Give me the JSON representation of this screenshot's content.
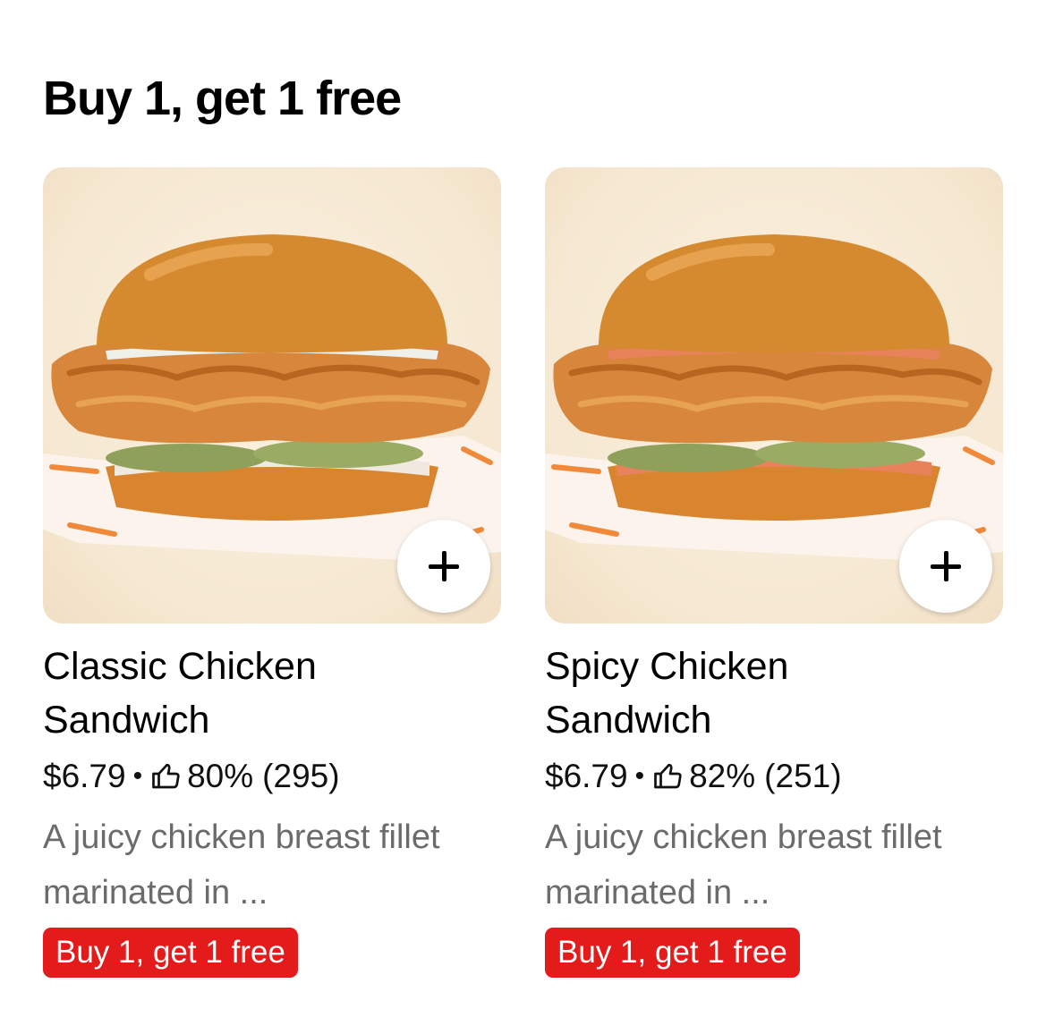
{
  "section": {
    "title": "Buy 1, get 1 free"
  },
  "items": [
    {
      "name": "Classic Chicken Sandwich",
      "price": "$6.79",
      "separator": "•",
      "rating": "80%",
      "rating_count": "(295)",
      "description": "A juicy chicken breast fillet marinated in ...",
      "promo": "Buy 1, get 1 free",
      "sauce_color": "#eef0ea",
      "add_icon": "plus-icon",
      "rating_icon": "thumbs-up-icon"
    },
    {
      "name": "Spicy Chicken Sandwich",
      "price": "$6.79",
      "separator": "•",
      "rating": "82%",
      "rating_count": "(251)",
      "description": "A juicy chicken breast fillet marinated in ...",
      "promo": "Buy 1, get 1 free",
      "sauce_color": "#e8825a",
      "add_icon": "plus-icon",
      "rating_icon": "thumbs-up-icon"
    }
  ],
  "colors": {
    "promo_badge": "#e41b1b",
    "description_text": "#6b6b6b",
    "image_background": "#f6e8d2"
  }
}
